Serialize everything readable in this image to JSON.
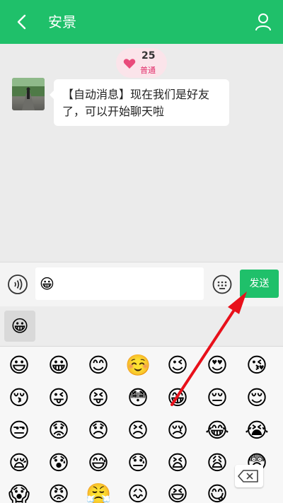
{
  "header": {
    "title": "安景",
    "colors": {
      "accent": "#1fc06a"
    }
  },
  "chat": {
    "intimacy": {
      "value": "25",
      "level": "普通"
    },
    "messages": [
      {
        "text_line1": "【自动消息】现在我们是好友",
        "text_line2": "了，可以开始聊天啦"
      }
    ]
  },
  "input": {
    "value": "😀",
    "send_label": "发送"
  },
  "emoji_tab": {
    "icon": "😀"
  },
  "emoji_grid": {
    "rows": [
      [
        "😃",
        "😀",
        "😊",
        "☺️",
        "😉",
        "😍",
        "😘"
      ],
      [
        "😚",
        "😜",
        "😝",
        "😳",
        "😁",
        "😔",
        "😌"
      ],
      [
        "😒",
        "😟",
        "😞",
        "😣",
        "😢",
        "😂",
        "😭"
      ],
      [
        "😪",
        "😰",
        "😅",
        "😓",
        "😫",
        "😩",
        "😨"
      ],
      [
        "😱",
        "😡",
        "😤",
        "😖",
        "😆",
        "😋",
        "😷"
      ]
    ]
  },
  "annotation": {
    "arrow_color": "#e8101a"
  }
}
